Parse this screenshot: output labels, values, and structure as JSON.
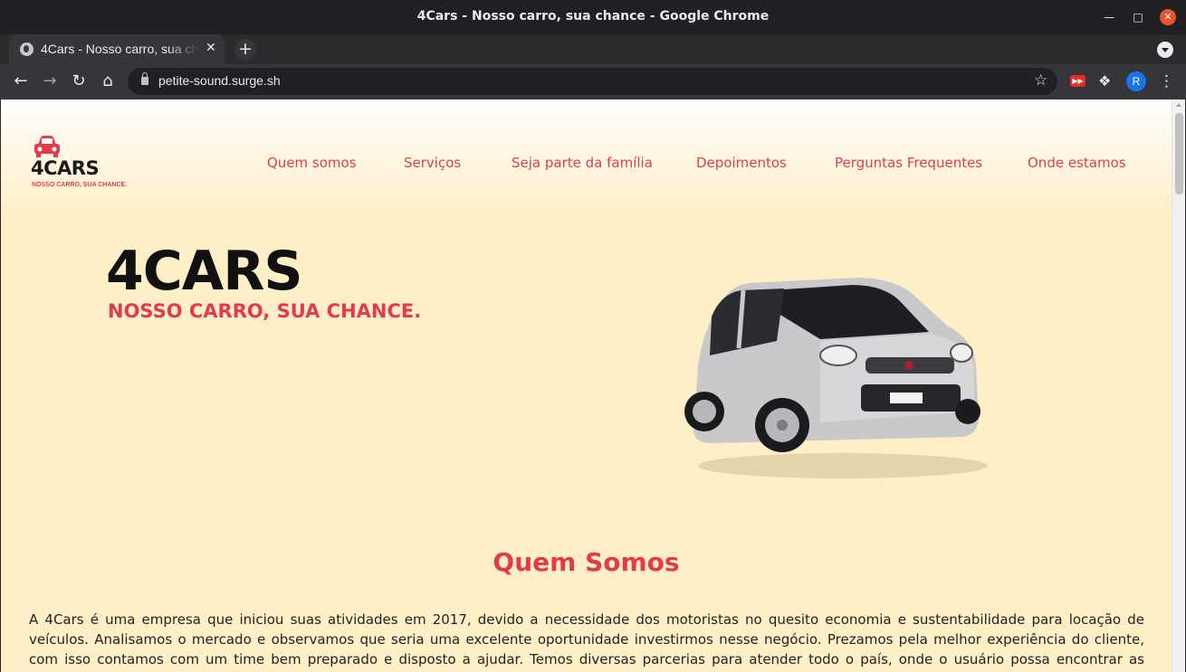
{
  "browser": {
    "window_title": "4Cars - Nosso carro, sua chance - Google Chrome",
    "tab_title": "4Cars - Nosso carro, sua chance",
    "url": "petite-sound.surge.sh",
    "profile_initial": "R",
    "accent_color": "#1a73e8"
  },
  "site": {
    "brand_color": "#e23b4e",
    "logo": {
      "text": "4CARS",
      "slogan": "NOSSO CARRO, SUA CHANCE."
    },
    "nav": [
      {
        "label": "Quem somos"
      },
      {
        "label": "Serviços"
      },
      {
        "label": "Seja parte da família"
      },
      {
        "label": "Depoimentos"
      },
      {
        "label": "Perguntas Frequentes"
      },
      {
        "label": "Onde estamos"
      }
    ],
    "hero": {
      "title": "4CARS",
      "subtitle": "NOSSO CARRO, SUA CHANCE."
    },
    "about": {
      "title": "Quem Somos",
      "body": "A 4Cars é uma empresa que iniciou suas atividades em 2017, devido a necessidade dos motoristas no quesito economia e sustentabilidade para locação de veículos. Analisamos o mercado e observamos que seria uma excelente oportunidade investirmos nesse negócio. Prezamos pela melhor experiência do cliente, com isso contamos com um time bem preparado e disposto a ajudar. Temos diversas parcerias para atender todo o país, onde o usuário possa encontrar as melhores opções desejadas."
    }
  }
}
